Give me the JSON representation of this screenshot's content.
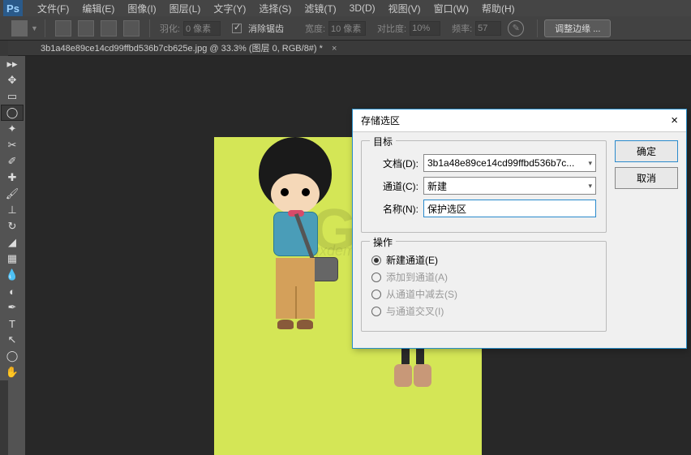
{
  "menubar": {
    "items": [
      "文件(F)",
      "编辑(E)",
      "图像(I)",
      "图层(L)",
      "文字(Y)",
      "选择(S)",
      "滤镜(T)",
      "3D(D)",
      "视图(V)",
      "窗口(W)",
      "帮助(H)"
    ]
  },
  "optionsbar": {
    "feather_label": "羽化:",
    "feather_value": "0 像素",
    "antialias_label": "消除锯齿",
    "width_label": "宽度:",
    "width_value": "10 像素",
    "contrast_label": "对比度:",
    "contrast_value": "10%",
    "frequency_label": "频率:",
    "frequency_value": "57",
    "refine_button": "调整边缘 ..."
  },
  "document_tab": {
    "label": "3b1a48e89ce14cd99ffbd536b7cb625e.jpg @ 33.3% (图层 0, RGB/8#) *",
    "close": "×"
  },
  "watermark": {
    "main": "GX 网",
    "sub": "gxdemo"
  },
  "dialog": {
    "title": "存储选区",
    "close": "×",
    "group_target": "目标",
    "doc_label": "文档(D):",
    "doc_value": "3b1a48e89ce14cd99ffbd536b7c...",
    "channel_label": "通道(C):",
    "channel_value": "新建",
    "name_label": "名称(N):",
    "name_value": "保护选区",
    "group_op": "操作",
    "ops": [
      {
        "label": "新建通道(E)",
        "checked": true,
        "disabled": false
      },
      {
        "label": "添加到通道(A)",
        "checked": false,
        "disabled": true
      },
      {
        "label": "从通道中减去(S)",
        "checked": false,
        "disabled": true
      },
      {
        "label": "与通道交叉(I)",
        "checked": false,
        "disabled": true
      }
    ],
    "ok": "确定",
    "cancel": "取消"
  }
}
